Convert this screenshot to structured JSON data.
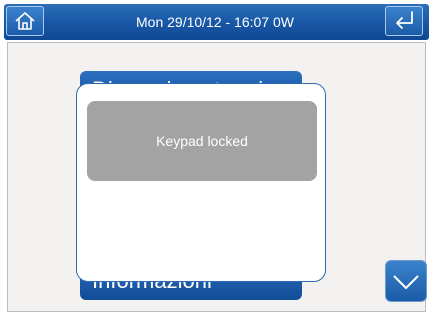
{
  "header": {
    "title": "Mon 29/10/12 - 16:07   0W",
    "home_icon": "home-icon",
    "back_icon": "return-arrow-icon"
  },
  "menu": {
    "items": [
      {
        "label": "Dispersione termica"
      },
      {
        "label": "Informazioni"
      }
    ],
    "scroll_icon": "chevron-down-icon"
  },
  "popup": {
    "message": "Keypad locked"
  },
  "colors": {
    "accent_blue": "#1a5aa8",
    "popup_message_bg": "#a3a3a3",
    "content_bg": "#f3f2f0"
  }
}
